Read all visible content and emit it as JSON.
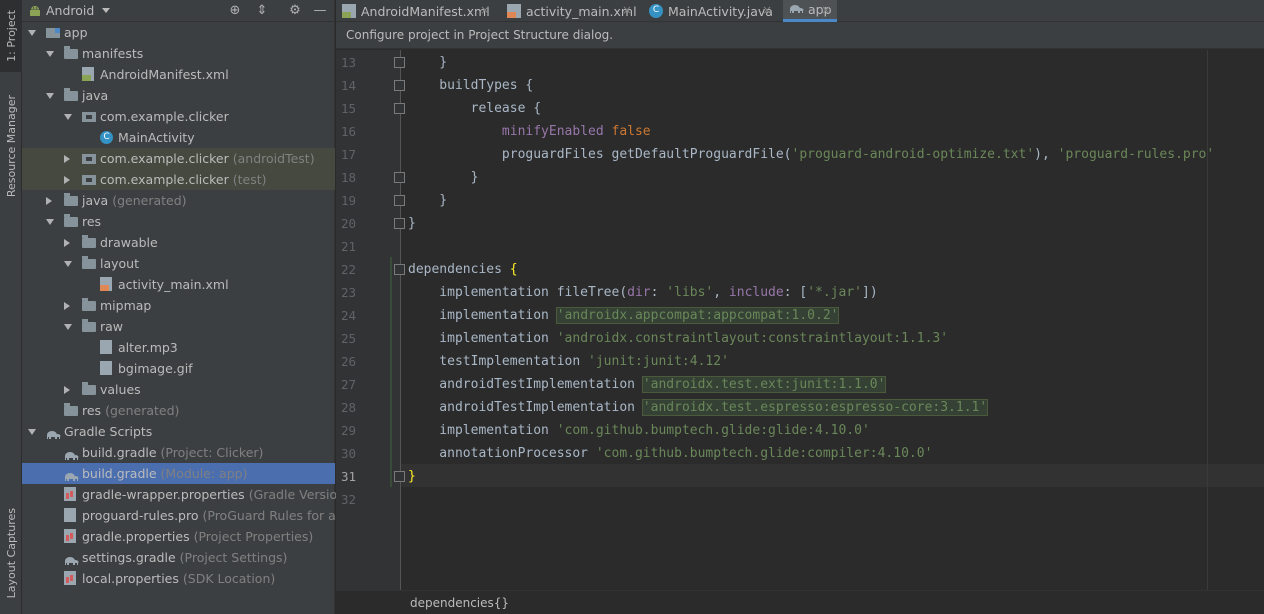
{
  "tool_strip": {
    "project_tab": "1: Project",
    "resource_tab": "Resource Manager",
    "captures_tab": "Layout Captures"
  },
  "project_panel": {
    "view": "Android",
    "tree": [
      {
        "label": "app",
        "hint": "",
        "depth": 0,
        "arrow": "down",
        "icon": "module",
        "state": ""
      },
      {
        "label": "manifests",
        "hint": "",
        "depth": 1,
        "arrow": "down",
        "icon": "folder",
        "state": ""
      },
      {
        "label": "AndroidManifest.xml",
        "hint": "",
        "depth": 2,
        "arrow": "",
        "icon": "manifest",
        "state": ""
      },
      {
        "label": "java",
        "hint": "",
        "depth": 1,
        "arrow": "down",
        "icon": "folder",
        "state": ""
      },
      {
        "label": "com.example.clicker",
        "hint": "",
        "depth": 2,
        "arrow": "down",
        "icon": "pkg",
        "state": ""
      },
      {
        "label": "MainActivity",
        "hint": "",
        "depth": 3,
        "arrow": "",
        "icon": "cls",
        "state": ""
      },
      {
        "label": "com.example.clicker",
        "hint": "(androidTest)",
        "depth": 2,
        "arrow": "right",
        "icon": "pkg",
        "state": "hl"
      },
      {
        "label": "com.example.clicker",
        "hint": "(test)",
        "depth": 2,
        "arrow": "right",
        "icon": "pkg",
        "state": "hl"
      },
      {
        "label": "java",
        "hint": "(generated)",
        "depth": 1,
        "arrow": "right",
        "icon": "folder",
        "state": ""
      },
      {
        "label": "res",
        "hint": "",
        "depth": 1,
        "arrow": "down",
        "icon": "folder",
        "state": ""
      },
      {
        "label": "drawable",
        "hint": "",
        "depth": 2,
        "arrow": "right",
        "icon": "folder",
        "state": ""
      },
      {
        "label": "layout",
        "hint": "",
        "depth": 2,
        "arrow": "down",
        "icon": "folder",
        "state": ""
      },
      {
        "label": "activity_main.xml",
        "hint": "",
        "depth": 3,
        "arrow": "",
        "icon": "xml",
        "state": ""
      },
      {
        "label": "mipmap",
        "hint": "",
        "depth": 2,
        "arrow": "right",
        "icon": "folder",
        "state": ""
      },
      {
        "label": "raw",
        "hint": "",
        "depth": 2,
        "arrow": "down",
        "icon": "folder",
        "state": ""
      },
      {
        "label": "alter.mp3",
        "hint": "",
        "depth": 3,
        "arrow": "",
        "icon": "file",
        "state": ""
      },
      {
        "label": "bgimage.gif",
        "hint": "",
        "depth": 3,
        "arrow": "",
        "icon": "file",
        "state": ""
      },
      {
        "label": "values",
        "hint": "",
        "depth": 2,
        "arrow": "right",
        "icon": "folder",
        "state": ""
      },
      {
        "label": "res",
        "hint": "(generated)",
        "depth": 1,
        "arrow": "",
        "icon": "folder",
        "state": ""
      },
      {
        "label": "Gradle Scripts",
        "hint": "",
        "depth": 0,
        "arrow": "down",
        "icon": "elephant",
        "state": ""
      },
      {
        "label": "build.gradle",
        "hint": "(Project: Clicker)",
        "depth": 1,
        "arrow": "",
        "icon": "elephant",
        "state": ""
      },
      {
        "label": "build.gradle",
        "hint": "(Module: app)",
        "depth": 1,
        "arrow": "",
        "icon": "elephant",
        "state": "sel"
      },
      {
        "label": "gradle-wrapper.properties",
        "hint": "(Gradle Version)",
        "depth": 1,
        "arrow": "",
        "icon": "props",
        "state": ""
      },
      {
        "label": "proguard-rules.pro",
        "hint": "(ProGuard Rules for app)",
        "depth": 1,
        "arrow": "",
        "icon": "file",
        "state": ""
      },
      {
        "label": "gradle.properties",
        "hint": "(Project Properties)",
        "depth": 1,
        "arrow": "",
        "icon": "props",
        "state": ""
      },
      {
        "label": "settings.gradle",
        "hint": "(Project Settings)",
        "depth": 1,
        "arrow": "",
        "icon": "elephant",
        "state": ""
      },
      {
        "label": "local.properties",
        "hint": "(SDK Location)",
        "depth": 1,
        "arrow": "",
        "icon": "props",
        "state": ""
      }
    ]
  },
  "editor": {
    "tabs": [
      {
        "label": "AndroidManifest.xml",
        "icon": "manifest",
        "active": false
      },
      {
        "label": "activity_main.xml",
        "icon": "xml",
        "active": false
      },
      {
        "label": "MainActivity.java",
        "icon": "cls",
        "active": false
      },
      {
        "label": "app",
        "icon": "elephant",
        "active": true
      }
    ],
    "notification": "Configure project in Project Structure dialog.",
    "current_line": 31,
    "lines": [
      {
        "n": 13,
        "fold": true,
        "parts": [
          [
            "",
            "    }"
          ]
        ]
      },
      {
        "n": 14,
        "fold": true,
        "parts": [
          [
            "",
            "    buildTypes {"
          ]
        ]
      },
      {
        "n": 15,
        "fold": true,
        "parts": [
          [
            "",
            "        release {"
          ]
        ]
      },
      {
        "n": 16,
        "fold": false,
        "parts": [
          [
            "",
            "            "
          ],
          [
            "prop",
            "minifyEnabled"
          ],
          [
            "",
            ""
          ],
          [
            "kw",
            " false"
          ]
        ]
      },
      {
        "n": 17,
        "fold": false,
        "parts": [
          [
            "",
            "            proguardFiles getDefaultProguardFile("
          ],
          [
            "str",
            "'proguard-android-optimize.txt'"
          ],
          [
            "",
            "), "
          ],
          [
            "str",
            "'proguard-rules.pro'"
          ]
        ]
      },
      {
        "n": 18,
        "fold": true,
        "parts": [
          [
            "",
            "        }"
          ]
        ]
      },
      {
        "n": 19,
        "fold": true,
        "parts": [
          [
            "",
            "    }"
          ]
        ]
      },
      {
        "n": 20,
        "fold": true,
        "parts": [
          [
            "",
            "}"
          ]
        ]
      },
      {
        "n": 21,
        "fold": false,
        "parts": [
          [
            "",
            ""
          ]
        ]
      },
      {
        "n": 22,
        "fold": true,
        "parts": [
          [
            "",
            "dependencies "
          ],
          [
            "br",
            "{"
          ]
        ]
      },
      {
        "n": 23,
        "fold": false,
        "parts": [
          [
            "",
            "    implementation fileTree("
          ],
          [
            "prop",
            "dir"
          ],
          [
            "",
            ": "
          ],
          [
            "str",
            "'libs'"
          ],
          [
            "",
            ", "
          ],
          [
            "prop",
            "include"
          ],
          [
            "",
            ": ["
          ],
          [
            "str",
            "'*.jar'"
          ],
          [
            "",
            "])"
          ]
        ]
      },
      {
        "n": 24,
        "fold": false,
        "parts": [
          [
            "",
            "    implementation "
          ],
          [
            "strhl",
            "'androidx.appcompat:appcompat:1.0.2'"
          ]
        ]
      },
      {
        "n": 25,
        "fold": false,
        "parts": [
          [
            "",
            "    implementation "
          ],
          [
            "str",
            "'androidx.constraintlayout:constraintlayout:1.1.3'"
          ]
        ]
      },
      {
        "n": 26,
        "fold": false,
        "parts": [
          [
            "",
            "    testImplementation "
          ],
          [
            "str",
            "'junit:junit:4.12'"
          ]
        ]
      },
      {
        "n": 27,
        "fold": false,
        "parts": [
          [
            "",
            "    androidTestImplementation "
          ],
          [
            "strhl",
            "'androidx.test.ext:junit:1.1.0'"
          ]
        ]
      },
      {
        "n": 28,
        "fold": false,
        "parts": [
          [
            "",
            "    androidTestImplementation "
          ],
          [
            "strhl",
            "'androidx.test.espresso:espresso-core:3.1.1'"
          ]
        ]
      },
      {
        "n": 29,
        "fold": false,
        "parts": [
          [
            "",
            "    implementation "
          ],
          [
            "str",
            "'com.github.bumptech.glide:glide:4.10.0'"
          ]
        ]
      },
      {
        "n": 30,
        "fold": false,
        "parts": [
          [
            "",
            "    annotationProcessor "
          ],
          [
            "str",
            "'com.github.bumptech.glide:compiler:4.10.0'"
          ]
        ]
      },
      {
        "n": 31,
        "fold": true,
        "parts": [
          [
            "br",
            "}"
          ]
        ]
      },
      {
        "n": 32,
        "fold": false,
        "parts": [
          [
            "",
            ""
          ]
        ]
      }
    ],
    "breadcrumb": "dependencies{}"
  },
  "colors": {
    "selection": "#4b6eaf",
    "keyword": "#cc7832",
    "string": "#6a8759",
    "property": "#9876aa",
    "brace_match": "#ffef28"
  }
}
